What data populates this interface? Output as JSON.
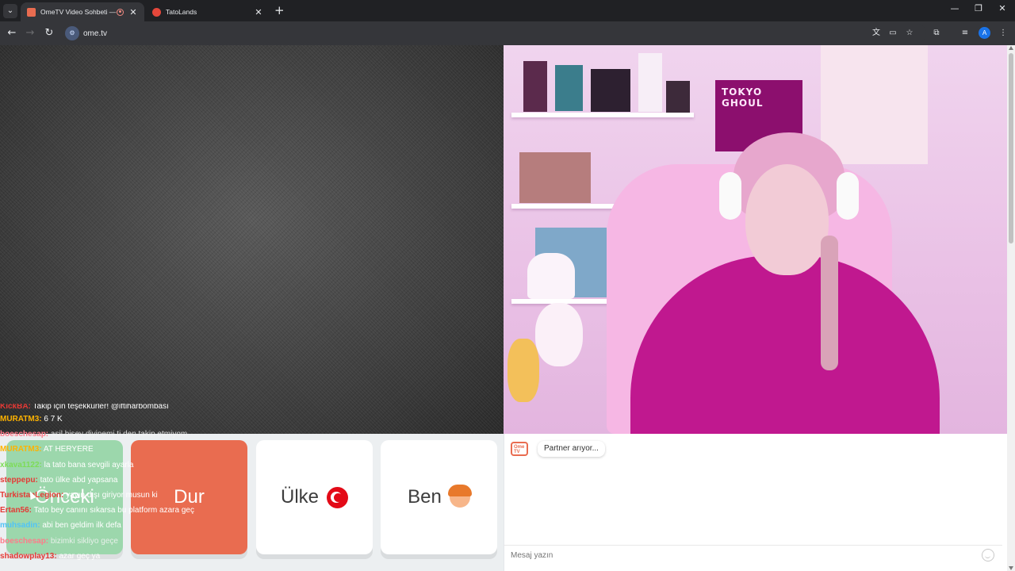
{
  "browser": {
    "tabs": [
      {
        "title": "OmeTV Video Sohbeti — C",
        "active": true,
        "favicon_color": "#e96c50"
      },
      {
        "title": "TatoLands",
        "active": false,
        "favicon_color": "#e5473b"
      }
    ],
    "url": "ome.tv",
    "window_controls": {
      "minimize": "—",
      "restore": "❐",
      "close": "✕"
    }
  },
  "chat_overlay": [
    {
      "user": "KickBA:",
      "message": "Takip için teşekkürler! @iftiharbombası",
      "user_color": "#e53935",
      "cut": true
    },
    {
      "user": "MURATM3:",
      "message": "6 7 K",
      "user_color": "#ffb300"
    },
    {
      "user": "boeschesap:",
      "message": "asil bisey diyinemi ti den takip etmiyom",
      "user_color": "#ff7b8a",
      "faded": true
    },
    {
      "user": "MURATM3:",
      "message": "AT HERYERE",
      "user_color": "#ffb300"
    },
    {
      "user": "xkava1122:",
      "message": "la tato bana sevgili ayarla",
      "user_color": "#7ddc57"
    },
    {
      "user": "steppepu:",
      "message": "tato ülke abd yapsana",
      "user_color": "#e53935"
    },
    {
      "user": "TurkistanLegion:",
      "message": "yayın dışı giriyor musun ki",
      "user_color": "#e53935"
    },
    {
      "user": "Ertan56:",
      "message": "Tato bey canını sıkarsa bu platform azara geç",
      "user_color": "#e53935"
    },
    {
      "user": "muhsadin:",
      "message": "abi ben geldim ilk defa",
      "user_color": "#4fc3f7"
    },
    {
      "user": "boeschesap:",
      "message": "bizimki sikliyo geçe",
      "user_color": "#ff7b8a",
      "faded": true
    },
    {
      "user": "shadowplay13:",
      "message": "azar geç ya",
      "user_color": "#e53935"
    }
  ],
  "controls": {
    "next": "Önceki",
    "stop": "Dur",
    "country": "Ülke",
    "me": "Ben"
  },
  "chat_panel": {
    "logo": "Ome TV",
    "status": "Partner arıyor...",
    "input_placeholder": "Mesaj yazın"
  },
  "colors": {
    "stop_button": "#e96c50",
    "next_button": "#8fd3a1",
    "page_background": "#eceff1"
  },
  "video_right": {
    "poster_text": "TOKYO GHOUL"
  }
}
